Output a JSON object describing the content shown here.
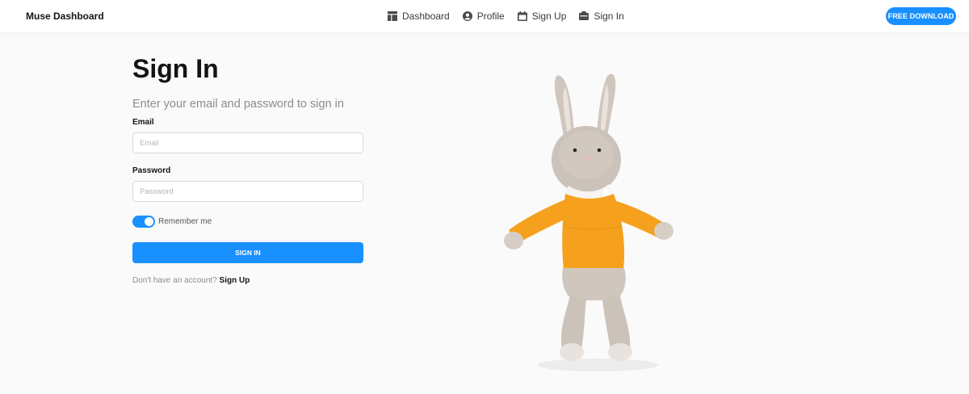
{
  "header": {
    "brand": "Muse Dashboard",
    "nav": [
      {
        "label": "Dashboard",
        "icon": "dashboard-icon"
      },
      {
        "label": "Profile",
        "icon": "profile-icon"
      },
      {
        "label": "Sign Up",
        "icon": "signup-icon"
      },
      {
        "label": "Sign In",
        "icon": "signin-icon"
      }
    ],
    "cta_label": "FREE DOWNLOAD"
  },
  "form": {
    "title": "Sign In",
    "subtitle": "Enter your email and password to sign in",
    "email_label": "Email",
    "email_placeholder": "Email",
    "email_value": "",
    "password_label": "Password",
    "password_placeholder": "Password",
    "password_value": "",
    "remember_label": "Remember me",
    "remember_checked": true,
    "submit_label": "SIGN IN",
    "footer_prompt": "Don't have an account?",
    "footer_link": "Sign Up"
  },
  "colors": {
    "accent": "#1890ff",
    "background": "#fafafa",
    "text": "#141414",
    "muted": "#8c8c8c"
  },
  "illustration": {
    "icon": "crochet-bunny-image"
  }
}
